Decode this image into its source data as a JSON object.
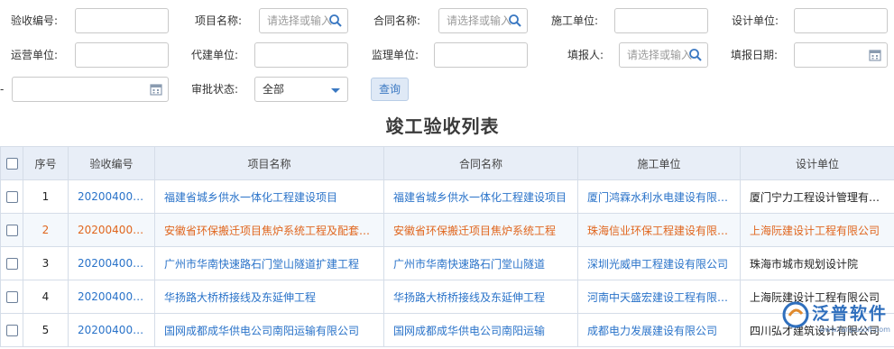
{
  "filters": {
    "acceptance_no_label": "验收编号:",
    "project_name_label": "项目名称:",
    "project_name_placeholder": "请选择或输入",
    "contract_name_label": "合同名称:",
    "contract_name_placeholder": "请选择或输入",
    "construction_unit_label": "施工单位:",
    "design_unit_label": "设计单位:",
    "operation_unit_label": "运营单位:",
    "agent_build_unit_label": "代建单位:",
    "supervision_unit_label": "监理单位:",
    "reporter_label": "填报人:",
    "reporter_placeholder": "请选择或输入",
    "report_date_label": "填报日期:",
    "approval_status_label": "审批状态:",
    "approval_status_value": "全部",
    "query_label": "查询"
  },
  "page_title": "竣工验收列表",
  "table": {
    "headers": [
      "",
      "序号",
      "验收编号",
      "项目名称",
      "合同名称",
      "施工单位",
      "设计单位"
    ],
    "rows": [
      {
        "seq": "1",
        "no": "2020040006",
        "project": "福建省城乡供水一体化工程建设项目",
        "contract": "福建省城乡供水一体化工程建设项目",
        "builder": "厦门鸿霖水利水电建设有限公司",
        "designer": "厦门宁力工程设计管理有限公司"
      },
      {
        "seq": "2",
        "no": "2020040007",
        "project": "安徽省环保搬迁项目焦炉系统工程及配套工程",
        "contract": "安徽省环保搬迁项目焦炉系统工程",
        "builder": "珠海信业环保工程建设有限公司",
        "designer": "上海阮建设计工程有限公司"
      },
      {
        "seq": "3",
        "no": "2020040008",
        "project": "广州市华南快速路石门堂山隧道扩建工程",
        "contract": "广州市华南快速路石门堂山隧道",
        "builder": "深圳光威申工程建设有限公司",
        "designer": "珠海市城市规划设计院"
      },
      {
        "seq": "4",
        "no": "2020040009",
        "project": "华扬路大桥桥接线及东延伸工程",
        "contract": "华扬路大桥桥接线及东延伸工程",
        "builder": "河南中天盛宏建设工程有限公司",
        "designer": "上海阮建设计工程有限公司"
      },
      {
        "seq": "5",
        "no": "2020040010",
        "project": "国网成都成华供电公司南阳运输有限公司",
        "contract": "国网成都成华供电公司南阳运输",
        "builder": "成都电力发展建设有限公司",
        "designer": "四川弘才建筑设计有限公司"
      }
    ]
  },
  "watermark": {
    "brand": "泛普软件",
    "site": "www.fanpusoft.com"
  },
  "colors": {
    "link": "#2a73c9",
    "highlight_row_text": "#e0661e",
    "header_bg": "#e8eef7",
    "query_btn_bg": "#dfe9f6"
  },
  "icons": {
    "search": "search-icon",
    "calendar": "calendar-icon",
    "dropdown": "caret-down-icon"
  }
}
